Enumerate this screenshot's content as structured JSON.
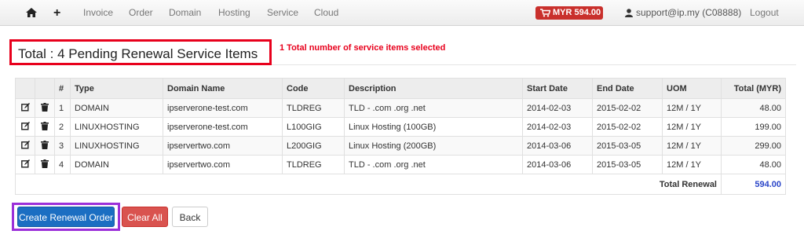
{
  "navbar": {
    "home_icon": "home-icon",
    "plus_label": "+",
    "items": [
      "Invoice",
      "Order",
      "Domain",
      "Hosting",
      "Service",
      "Cloud"
    ],
    "cart_label": "MYR 594.00",
    "user_label": "support@ip.my (C08888)",
    "logout_label": "Logout"
  },
  "page": {
    "title": "Total : 4 Pending Renewal Service Items",
    "annotation": "1 Total number of service items selected"
  },
  "table": {
    "headers": [
      "#",
      "Type",
      "Domain Name",
      "Code",
      "Description",
      "Start Date",
      "End Date",
      "UOM",
      "Total (MYR)"
    ],
    "rows": [
      {
        "n": "1",
        "type": "DOMAIN",
        "domain": "ipserverone-test.com",
        "code": "TLDREG",
        "desc": "TLD - .com .org .net",
        "start": "2014-02-03",
        "end": "2015-02-02",
        "uom": "12M / 1Y",
        "total": "48.00"
      },
      {
        "n": "2",
        "type": "LINUXHOSTING",
        "domain": "ipserverone-test.com",
        "code": "L100GIG",
        "desc": "Linux Hosting (100GB)",
        "start": "2014-02-03",
        "end": "2015-02-02",
        "uom": "12M / 1Y",
        "total": "199.00"
      },
      {
        "n": "3",
        "type": "LINUXHOSTING",
        "domain": "ipservertwo.com",
        "code": "L200GIG",
        "desc": "Linux Hosting (200GB)",
        "start": "2014-03-06",
        "end": "2015-03-05",
        "uom": "12M / 1Y",
        "total": "299.00"
      },
      {
        "n": "4",
        "type": "DOMAIN",
        "domain": "ipservertwo.com",
        "code": "TLDREG",
        "desc": "TLD - .com .org .net",
        "start": "2014-03-06",
        "end": "2015-03-05",
        "uom": "12M / 1Y",
        "total": "48.00"
      }
    ],
    "total_label": "Total Renewal",
    "total_value": "594.00"
  },
  "actions": {
    "create_label": "Create Renewal Order",
    "clear_label": "Clear All",
    "back_label": "Back"
  },
  "colors": {
    "accent_red": "#e8001c",
    "accent_purple": "#9b30d9",
    "primary_button": "#1b6ec2",
    "danger_button": "#d9534f",
    "total_value": "#2a45c8"
  }
}
